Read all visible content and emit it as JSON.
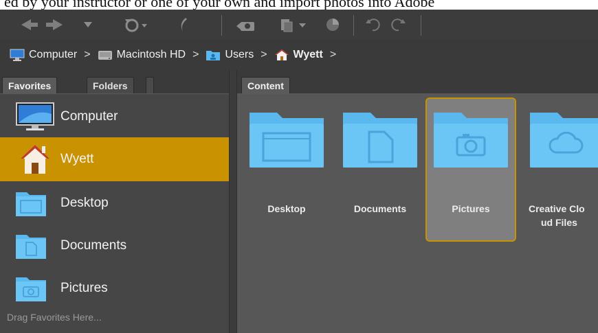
{
  "caption": "ed by your instructor or one of your own and import photos into Adobe",
  "toolbar": {
    "items": [
      "back-icon",
      "forward-icon",
      "history-dropdown-icon",
      "rotate-icon",
      "boomerang-icon",
      "camera-import-icon",
      "copy-icon",
      "refine-icon",
      "rotate-left-icon",
      "rotate-right-icon"
    ]
  },
  "breadcrumb": [
    {
      "label": "Computer",
      "icon": "computer-icon"
    },
    {
      "label": "Macintosh HD",
      "icon": "hard-drive-icon"
    },
    {
      "label": "Users",
      "icon": "users-folder-icon"
    },
    {
      "label": "Wyett",
      "icon": "home-icon"
    }
  ],
  "separator": ">",
  "left_tabs": {
    "favorites": "Favorites",
    "folders": "Folders"
  },
  "right_tabs": {
    "content": "Content"
  },
  "favorites": [
    {
      "label": "Computer",
      "icon": "computer-icon"
    },
    {
      "label": "Wyett",
      "icon": "home-icon",
      "selected": true
    },
    {
      "label": "Desktop",
      "icon": "desktop-folder-icon"
    },
    {
      "label": "Documents",
      "icon": "documents-folder-icon"
    },
    {
      "label": "Pictures",
      "icon": "pictures-folder-icon"
    }
  ],
  "drag_hint": "Drag Favorites Here...",
  "content": [
    {
      "label": "Desktop",
      "icon": "desktop-folder-icon"
    },
    {
      "label": "Documents",
      "icon": "documents-folder-icon"
    },
    {
      "label": "Pictures",
      "icon": "pictures-folder-icon",
      "selected": true
    },
    {
      "label_line1": "Creative Clo",
      "label_line2": "ud Files",
      "icon": "creative-cloud-folder-icon"
    }
  ],
  "colors": {
    "selection": "#c99200",
    "folder": "#5ab8ef",
    "folder_tab": "#6cc6f5"
  }
}
